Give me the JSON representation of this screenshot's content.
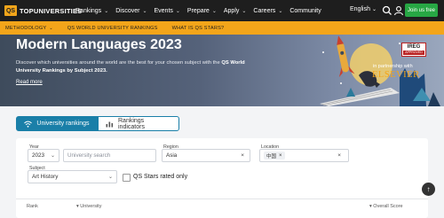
{
  "brand": {
    "logo_mark": "QS",
    "logo_text": "TOPUNIVERSITIES"
  },
  "nav": {
    "items": [
      "Rankings",
      "Discover",
      "Events",
      "Prepare",
      "Apply",
      "Careers",
      "Community"
    ],
    "language": "English",
    "join_label": "Join us free"
  },
  "subnav": {
    "items": [
      "METHODOLOGY",
      "QS WORLD UNIVERSITY RANKINGS",
      "WHAT IS QS STARS?"
    ]
  },
  "hero": {
    "title": "Modern Languages 2023",
    "desc_pre": "Discover which universities around the world are the best for your chosen subject with the ",
    "desc_bold": "QS World University Rankings by Subject 2023.",
    "read_more": "Read more",
    "ireg_title": "IREG",
    "ireg_sub": "APPROVED",
    "partner_text": "in partnership with",
    "partner_name": "ELSEVIER"
  },
  "tabs": {
    "rankings": "University rankings",
    "indicators": "Rankings indicators"
  },
  "filters": {
    "year_label": "Year",
    "year_value": "2023",
    "university_placeholder": "University search",
    "region_label": "Region",
    "region_value": "Asia",
    "location_label": "Location",
    "location_chip": "中国",
    "subject_label": "Subject",
    "subject_value": "Art History",
    "stars_label": "QS Stars rated only"
  },
  "table": {
    "col_rank": "Rank",
    "col_university": "University",
    "col_score": "Overall Score"
  },
  "colors": {
    "brand_orange": "#f3a51a",
    "accent_blue": "#1a7fa8",
    "join_green": "#27a744"
  }
}
